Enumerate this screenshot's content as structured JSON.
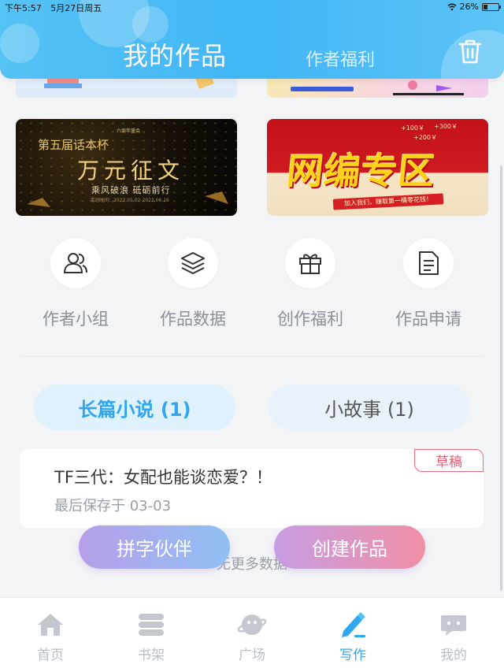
{
  "status_bar": {
    "time": "下午5:57",
    "date": "5月27日周五",
    "battery": "26%",
    "battery_level": 0.26
  },
  "header": {
    "tab_my_works": "我的作品",
    "tab_author_benefits": "作者福利",
    "trash_icon": "trash-icon"
  },
  "banners": {
    "essay": {
      "small_text": "六周年盛会",
      "series": "第五届话本杯",
      "title": "万元征文",
      "subtitle": "乘风破浪 砥砺前行",
      "date": "活动时间：2022.05.02-2022.06.16"
    },
    "web": {
      "bonus1": "+100￥",
      "bonus2": "+300￥",
      "bonus3": "+200￥",
      "title": "网编专区",
      "ribbon": "加入我们，赚取第一桶零花钱！"
    }
  },
  "actions": [
    {
      "label": "作者小组",
      "icon": "group-icon"
    },
    {
      "label": "作品数据",
      "icon": "layers-icon"
    },
    {
      "label": "创作福利",
      "icon": "gift-icon"
    },
    {
      "label": "作品申请",
      "icon": "document-icon"
    }
  ],
  "type_tabs": {
    "long": "长篇小说 (1)",
    "short": "小故事 (1)"
  },
  "work": {
    "badge": "草稿",
    "title": "TF三代：女配也能谈恋爱？！",
    "saved": "最后保存于 03-03"
  },
  "no_more": "无更多数据",
  "buttons": {
    "partner": "拼字伙伴",
    "create": "创建作品"
  },
  "nav": [
    {
      "label": "首页",
      "icon": "home-icon"
    },
    {
      "label": "书架",
      "icon": "bookshelf-icon"
    },
    {
      "label": "广场",
      "icon": "planet-icon"
    },
    {
      "label": "写作",
      "icon": "pen-icon",
      "active": true
    },
    {
      "label": "我的",
      "icon": "chat-bubble-icon"
    }
  ],
  "colors": {
    "accent": "#2fa6ee",
    "header": "#41b5f5",
    "draft": "#e85c72"
  }
}
